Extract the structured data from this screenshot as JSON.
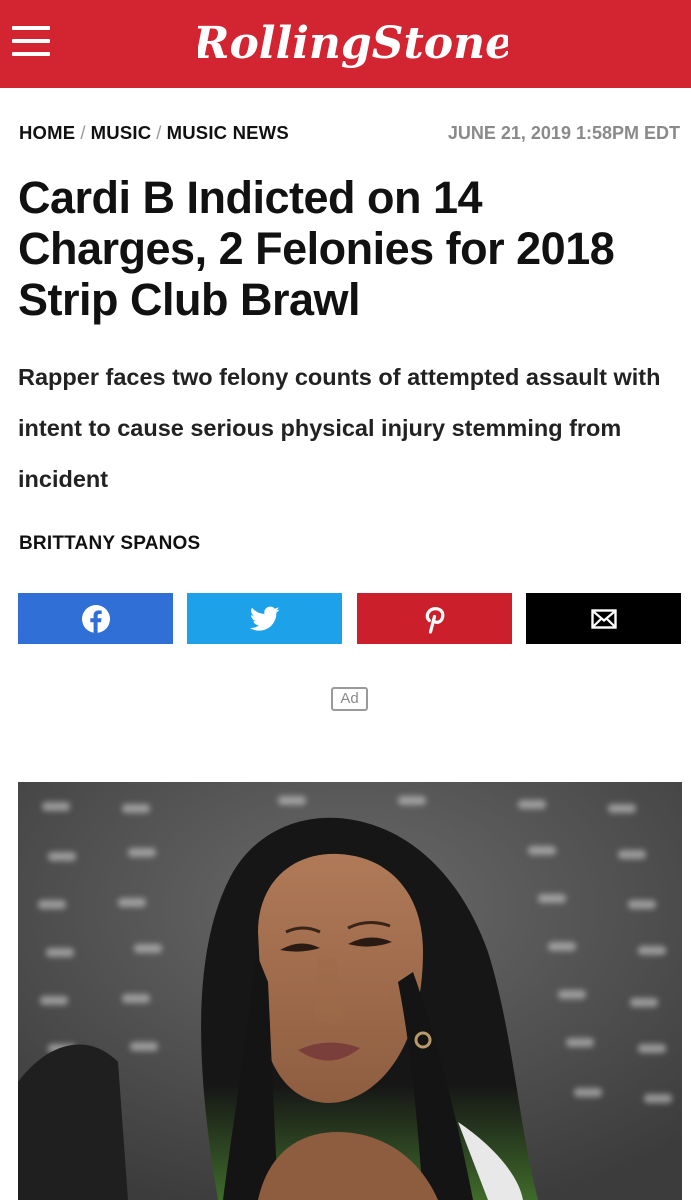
{
  "header": {
    "brand": "RollingStone",
    "brand_color": "#d32531"
  },
  "breadcrumb": {
    "items": [
      "HOME",
      "MUSIC",
      "MUSIC NEWS"
    ],
    "separator": "/"
  },
  "article": {
    "date": "JUNE 21, 2019 1:58PM EDT",
    "headline": "Cardi B Indicted on 14 Charges, 2 Felonies for 2018 Strip Club Brawl",
    "dek": "Rapper faces two felony counts of attempted assault with intent to cause serious physical injury stemming from incident",
    "author": "BRITTANY SPANOS"
  },
  "share": [
    {
      "network": "facebook",
      "icon": "facebook-icon",
      "color": "#2f6fd6"
    },
    {
      "network": "twitter",
      "icon": "twitter-icon",
      "color": "#1da1e8"
    },
    {
      "network": "pinterest",
      "icon": "pinterest-icon",
      "color": "#cc1f2c"
    },
    {
      "network": "email",
      "icon": "email-icon",
      "color": "#000000"
    }
  ],
  "ad": {
    "label": "Ad"
  }
}
